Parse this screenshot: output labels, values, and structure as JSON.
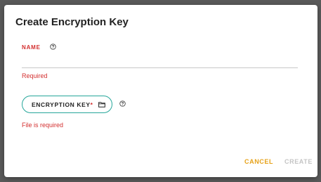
{
  "dialog": {
    "title": "Create Encryption Key",
    "name_field": {
      "label": "NAME",
      "value": "",
      "placeholder": "",
      "error": "Required"
    },
    "key_field": {
      "button_label": "ENCRYPTION KEY",
      "required_marker": "*",
      "error": "File is required"
    },
    "actions": {
      "cancel_label": "CANCEL",
      "create_label": "CREATE"
    }
  },
  "icons": {
    "help": "help-circle-icon",
    "folder": "folder-icon"
  },
  "colors": {
    "error": "#d32f2f",
    "accent_border": "#26a69a",
    "cancel": "#e6a117",
    "disabled": "#c4c4c4"
  }
}
